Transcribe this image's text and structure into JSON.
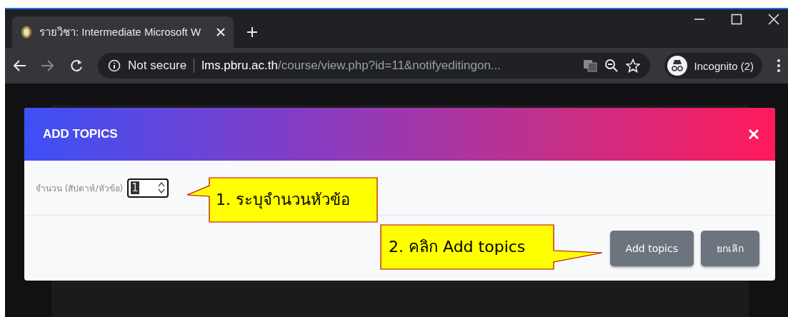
{
  "browser": {
    "tab": {
      "title": "รายวิชา: Intermediate Microsoft W",
      "selected": true
    },
    "address": {
      "security": "Not secure",
      "host": "lms.pbru.ac.th",
      "path": "/course/view.php?id=11&notifyeditingon..."
    },
    "profile": "Incognito (2)"
  },
  "modal": {
    "title": "ADD TOPICS",
    "field": {
      "label": "จำนวน (สัปดาห์/หัวข้อ)",
      "value": "1"
    },
    "buttons": [
      {
        "label": "Add topics"
      },
      {
        "label": "ยกเลิก"
      }
    ]
  },
  "callouts": [
    {
      "number": "1.",
      "text": "ระบุจำนวนหัวข้อ"
    },
    {
      "number": "2.",
      "text": "คลิก Add topics"
    }
  ]
}
